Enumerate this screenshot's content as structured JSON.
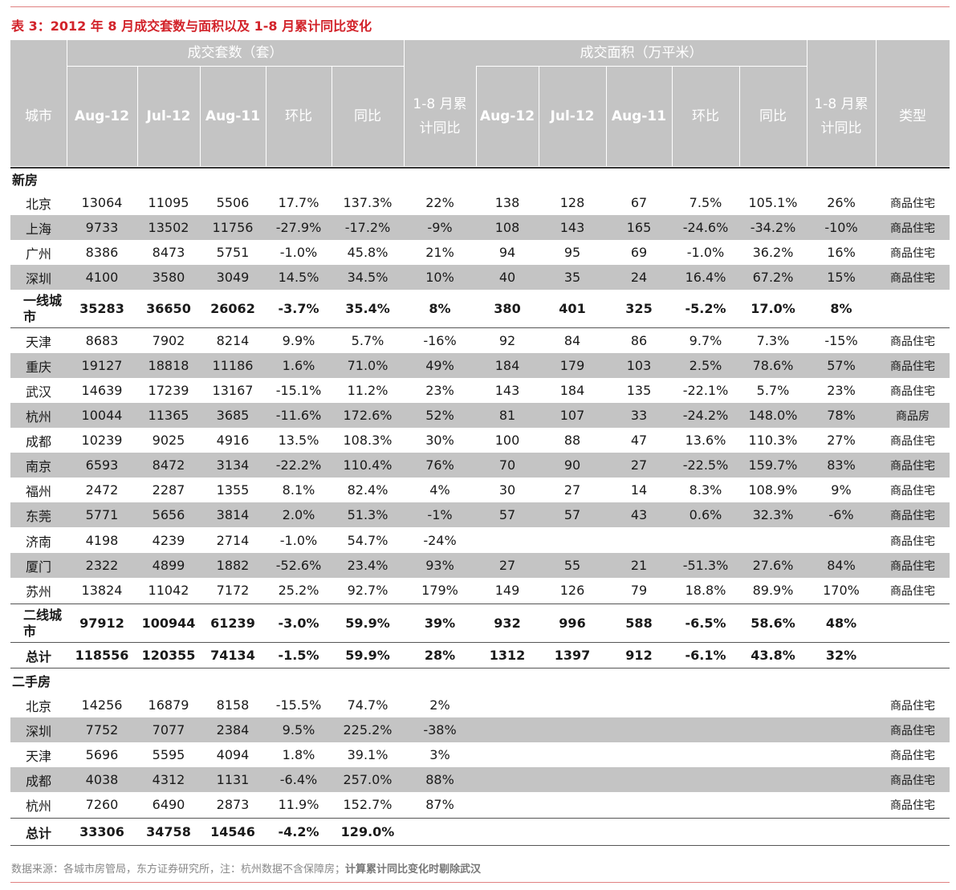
{
  "title": "表 3：2012 年 8 月成交套数与面积以及 1-8 月累计同比变化",
  "header": {
    "group_units": "成交套数（套）",
    "group_area": "成交面积（万平米）",
    "city": "城市",
    "cols_units": [
      "Aug-12",
      "Jul-12",
      "Aug-11",
      "环比",
      "同比",
      "1-8 月累计同比"
    ],
    "cols_area": [
      "Aug-12",
      "Jul-12",
      "Aug-11",
      "环比",
      "同比",
      "1-8 月累计同比"
    ],
    "type": "类型"
  },
  "sections": {
    "new": "新房",
    "second": "二手房"
  },
  "rows": [
    {
      "city": "北京",
      "vals": [
        "13064",
        "11095",
        "5506",
        "17.7%",
        "137.3%",
        "22%",
        "138",
        "128",
        "67",
        "7.5%",
        "105.1%",
        "26%"
      ],
      "type": "商品住宅"
    },
    {
      "city": "上海",
      "vals": [
        "9733",
        "13502",
        "11756",
        "-27.9%",
        "-17.2%",
        "-9%",
        "108",
        "143",
        "165",
        "-24.6%",
        "-34.2%",
        "-10%"
      ],
      "type": "商品住宅"
    },
    {
      "city": "广州",
      "vals": [
        "8386",
        "8473",
        "5751",
        "-1.0%",
        "45.8%",
        "21%",
        "94",
        "95",
        "69",
        "-1.0%",
        "36.2%",
        "16%"
      ],
      "type": "商品住宅"
    },
    {
      "city": "深圳",
      "vals": [
        "4100",
        "3580",
        "3049",
        "14.5%",
        "34.5%",
        "10%",
        "40",
        "35",
        "24",
        "16.4%",
        "67.2%",
        "15%"
      ],
      "type": "商品住宅"
    },
    {
      "city": "一线城市",
      "vals": [
        "35283",
        "36650",
        "26062",
        "-3.7%",
        "35.4%",
        "8%",
        "380",
        "401",
        "325",
        "-5.2%",
        "17.0%",
        "8%"
      ],
      "type": ""
    },
    {
      "city": "天津",
      "vals": [
        "8683",
        "7902",
        "8214",
        "9.9%",
        "5.7%",
        "-16%",
        "92",
        "84",
        "86",
        "9.7%",
        "7.3%",
        "-15%"
      ],
      "type": "商品住宅"
    },
    {
      "city": "重庆",
      "vals": [
        "19127",
        "18818",
        "11186",
        "1.6%",
        "71.0%",
        "49%",
        "184",
        "179",
        "103",
        "2.5%",
        "78.6%",
        "57%"
      ],
      "type": "商品住宅"
    },
    {
      "city": "武汉",
      "vals": [
        "14639",
        "17239",
        "13167",
        "-15.1%",
        "11.2%",
        "23%",
        "143",
        "184",
        "135",
        "-22.1%",
        "5.7%",
        "23%"
      ],
      "type": "商品住宅"
    },
    {
      "city": "杭州",
      "vals": [
        "10044",
        "11365",
        "3685",
        "-11.6%",
        "172.6%",
        "52%",
        "81",
        "107",
        "33",
        "-24.2%",
        "148.0%",
        "78%"
      ],
      "type": "商品房"
    },
    {
      "city": "成都",
      "vals": [
        "10239",
        "9025",
        "4916",
        "13.5%",
        "108.3%",
        "30%",
        "100",
        "88",
        "47",
        "13.6%",
        "110.3%",
        "27%"
      ],
      "type": "商品住宅"
    },
    {
      "city": "南京",
      "vals": [
        "6593",
        "8472",
        "3134",
        "-22.2%",
        "110.4%",
        "76%",
        "70",
        "90",
        "27",
        "-22.5%",
        "159.7%",
        "83%"
      ],
      "type": "商品住宅"
    },
    {
      "city": "福州",
      "vals": [
        "2472",
        "2287",
        "1355",
        "8.1%",
        "82.4%",
        "4%",
        "30",
        "27",
        "14",
        "8.3%",
        "108.9%",
        "9%"
      ],
      "type": "商品住宅"
    },
    {
      "city": "东莞",
      "vals": [
        "5771",
        "5656",
        "3814",
        "2.0%",
        "51.3%",
        "-1%",
        "57",
        "57",
        "43",
        "0.6%",
        "32.3%",
        "-6%"
      ],
      "type": "商品住宅"
    },
    {
      "city": "济南",
      "vals": [
        "4198",
        "4239",
        "2714",
        "-1.0%",
        "54.7%",
        "-24%",
        "",
        "",
        "",
        "",
        "",
        ""
      ],
      "type": "商品住宅"
    },
    {
      "city": "厦门",
      "vals": [
        "2322",
        "4899",
        "1882",
        "-52.6%",
        "23.4%",
        "93%",
        "27",
        "55",
        "21",
        "-51.3%",
        "27.6%",
        "84%"
      ],
      "type": "商品住宅"
    },
    {
      "city": "苏州",
      "vals": [
        "13824",
        "11042",
        "7172",
        "25.2%",
        "92.7%",
        "179%",
        "149",
        "126",
        "79",
        "18.8%",
        "89.9%",
        "170%"
      ],
      "type": "商品住宅"
    },
    {
      "city": "二线城市",
      "vals": [
        "97912",
        "100944",
        "61239",
        "-3.0%",
        "59.9%",
        "39%",
        "932",
        "996",
        "588",
        "-6.5%",
        "58.6%",
        "48%"
      ],
      "type": ""
    },
    {
      "city": "总计",
      "vals": [
        "118556",
        "120355",
        "74134",
        "-1.5%",
        "59.9%",
        "28%",
        "1312",
        "1397",
        "912",
        "-6.1%",
        "43.8%",
        "32%"
      ],
      "type": ""
    },
    {
      "city": "北京",
      "vals": [
        "14256",
        "16879",
        "8158",
        "-15.5%",
        "74.7%",
        "2%",
        "",
        "",
        "",
        "",
        "",
        ""
      ],
      "type": "商品住宅"
    },
    {
      "city": "深圳",
      "vals": [
        "7752",
        "7077",
        "2384",
        "9.5%",
        "225.2%",
        "-38%",
        "",
        "",
        "",
        "",
        "",
        ""
      ],
      "type": "商品住宅"
    },
    {
      "city": "天津",
      "vals": [
        "5696",
        "5595",
        "4094",
        "1.8%",
        "39.1%",
        "3%",
        "",
        "",
        "",
        "",
        "",
        ""
      ],
      "type": "商品住宅"
    },
    {
      "city": "成都",
      "vals": [
        "4038",
        "4312",
        "1131",
        "-6.4%",
        "257.0%",
        "88%",
        "",
        "",
        "",
        "",
        "",
        ""
      ],
      "type": "商品住宅"
    },
    {
      "city": "杭州",
      "vals": [
        "7260",
        "6490",
        "2873",
        "11.9%",
        "152.7%",
        "87%",
        "",
        "",
        "",
        "",
        "",
        ""
      ],
      "type": "商品住宅"
    },
    {
      "city": "总计",
      "vals": [
        "33306",
        "34758",
        "14546",
        "-4.2%",
        "129.0%",
        "",
        "",
        "",
        "",
        "",
        "",
        ""
      ],
      "type": ""
    }
  ],
  "footnote": {
    "text": "数据来源：各城市房管局，东方证券研究所，注：杭州数据不含保障房；",
    "bold": "计算累计同比变化时剔除武汉"
  }
}
